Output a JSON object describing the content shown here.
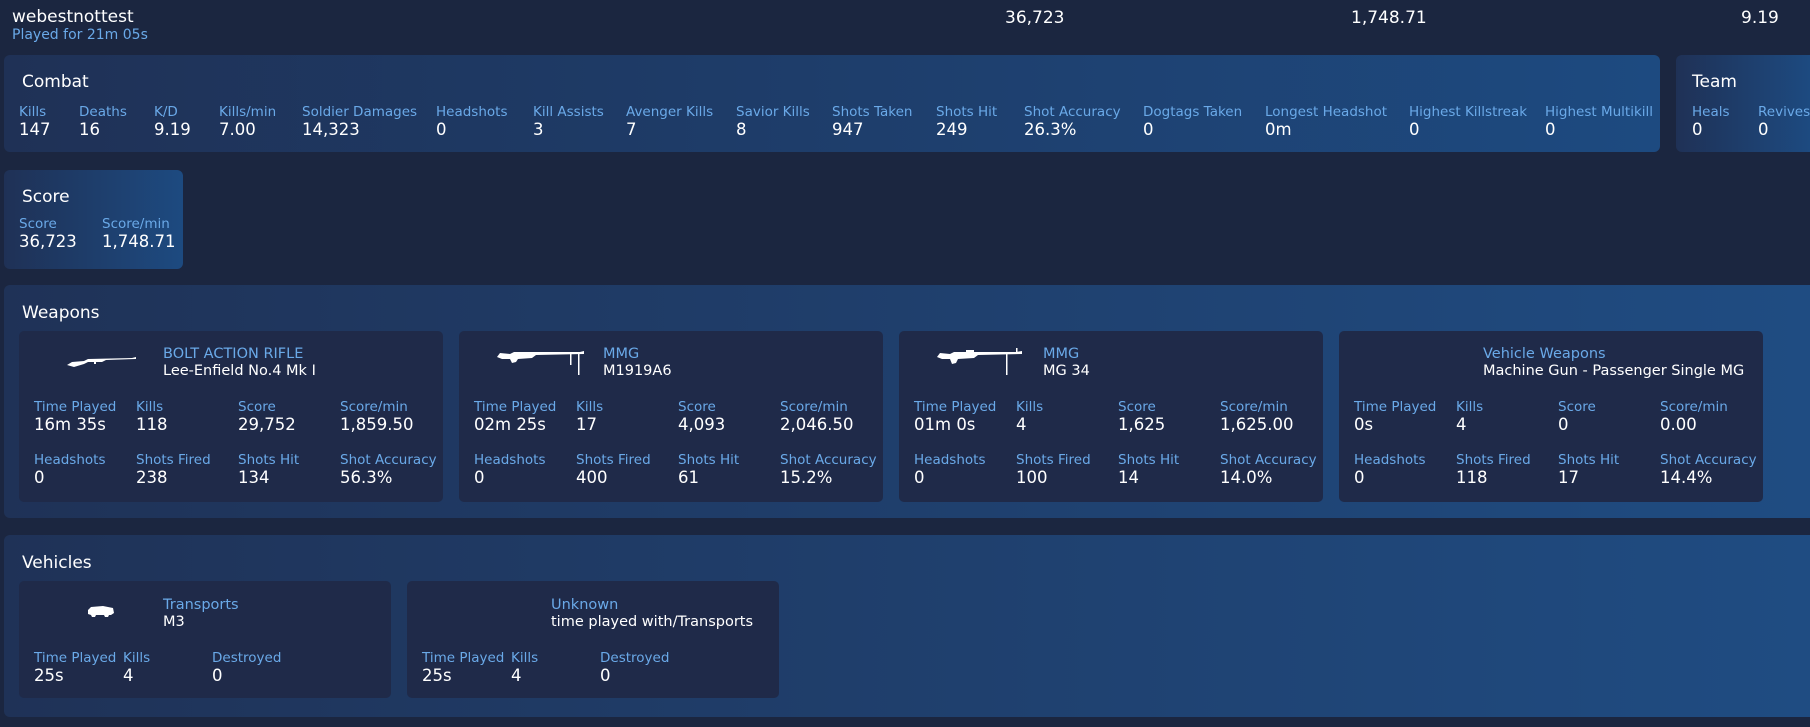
{
  "header": {
    "player": "webestnottest",
    "played": "Played for 21m 05s",
    "score": "36,723",
    "score_per_min": "1,748.71",
    "kd": "9.19"
  },
  "combat": {
    "title": "Combat",
    "stats": [
      {
        "label": "Kills",
        "value": "147"
      },
      {
        "label": "Deaths",
        "value": "16"
      },
      {
        "label": "K/D",
        "value": "9.19"
      },
      {
        "label": "Kills/min",
        "value": "7.00"
      },
      {
        "label": "Soldier Damages",
        "value": "14,323"
      },
      {
        "label": "Headshots",
        "value": "0"
      },
      {
        "label": "Kill Assists",
        "value": "3"
      },
      {
        "label": "Avenger Kills",
        "value": "7"
      },
      {
        "label": "Savior Kills",
        "value": "8"
      },
      {
        "label": "Shots Taken",
        "value": "947"
      },
      {
        "label": "Shots Hit",
        "value": "249"
      },
      {
        "label": "Shot Accuracy",
        "value": "26.3%"
      },
      {
        "label": "Dogtags Taken",
        "value": "0"
      },
      {
        "label": "Longest Headshot",
        "value": "0m"
      },
      {
        "label": "Highest Killstreak",
        "value": "0"
      },
      {
        "label": "Highest Multikill",
        "value": "0"
      }
    ]
  },
  "team": {
    "title": "Team",
    "stats": [
      {
        "label": "Heals",
        "value": "0"
      },
      {
        "label": "Revives",
        "value": "0"
      }
    ]
  },
  "score": {
    "title": "Score",
    "stats": [
      {
        "label": "Score",
        "value": "36,723"
      },
      {
        "label": "Score/min",
        "value": "1,748.71"
      }
    ]
  },
  "weapons": {
    "title": "Weapons",
    "items": [
      {
        "icon": "rifle-icon",
        "category": "BOLT ACTION RIFLE",
        "name": "Lee-Enfield No.4 Mk I",
        "stats": [
          {
            "label": "Time Played",
            "value": "16m 35s"
          },
          {
            "label": "Kills",
            "value": "118"
          },
          {
            "label": "Score",
            "value": "29,752"
          },
          {
            "label": "Score/min",
            "value": "1,859.50"
          },
          {
            "label": "Headshots",
            "value": "0"
          },
          {
            "label": "Shots Fired",
            "value": "238"
          },
          {
            "label": "Shots Hit",
            "value": "134"
          },
          {
            "label": "Shot Accuracy",
            "value": "56.3%"
          }
        ]
      },
      {
        "icon": "machine-gun-icon",
        "category": "MMG",
        "name": "M1919A6",
        "stats": [
          {
            "label": "Time Played",
            "value": "02m 25s"
          },
          {
            "label": "Kills",
            "value": "17"
          },
          {
            "label": "Score",
            "value": "4,093"
          },
          {
            "label": "Score/min",
            "value": "2,046.50"
          },
          {
            "label": "Headshots",
            "value": "0"
          },
          {
            "label": "Shots Fired",
            "value": "400"
          },
          {
            "label": "Shots Hit",
            "value": "61"
          },
          {
            "label": "Shot Accuracy",
            "value": "15.2%"
          }
        ]
      },
      {
        "icon": "machine-gun-icon",
        "category": "MMG",
        "name": "MG 34",
        "stats": [
          {
            "label": "Time Played",
            "value": "01m 0s"
          },
          {
            "label": "Kills",
            "value": "4"
          },
          {
            "label": "Score",
            "value": "1,625"
          },
          {
            "label": "Score/min",
            "value": "1,625.00"
          },
          {
            "label": "Headshots",
            "value": "0"
          },
          {
            "label": "Shots Fired",
            "value": "100"
          },
          {
            "label": "Shots Hit",
            "value": "14"
          },
          {
            "label": "Shot Accuracy",
            "value": "14.0%"
          }
        ]
      },
      {
        "icon": "",
        "category": "Vehicle Weapons",
        "name": "Machine Gun - Passenger Single MG",
        "stats": [
          {
            "label": "Time Played",
            "value": "0s"
          },
          {
            "label": "Kills",
            "value": "4"
          },
          {
            "label": "Score",
            "value": "0"
          },
          {
            "label": "Score/min",
            "value": "0.00"
          },
          {
            "label": "Headshots",
            "value": "0"
          },
          {
            "label": "Shots Fired",
            "value": "118"
          },
          {
            "label": "Shots Hit",
            "value": "17"
          },
          {
            "label": "Shot Accuracy",
            "value": "14.4%"
          }
        ]
      }
    ]
  },
  "vehicles": {
    "title": "Vehicles",
    "items": [
      {
        "icon": "truck-icon",
        "category": "Transports",
        "name": "M3",
        "stats": [
          {
            "label": "Time Played",
            "value": "25s"
          },
          {
            "label": "Kills",
            "value": "4"
          },
          {
            "label": "Destroyed",
            "value": "0"
          }
        ]
      },
      {
        "icon": "",
        "category": "Unknown",
        "name": "time played with/Transports",
        "stats": [
          {
            "label": "Time Played",
            "value": "25s"
          },
          {
            "label": "Kills",
            "value": "4"
          },
          {
            "label": "Destroyed",
            "value": "0"
          }
        ]
      }
    ]
  }
}
